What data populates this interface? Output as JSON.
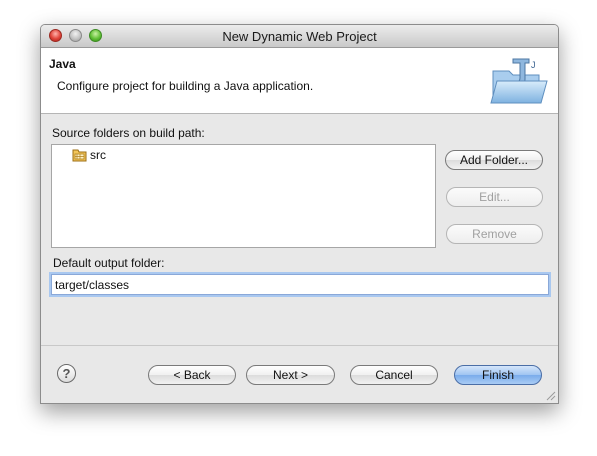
{
  "window": {
    "title": "New Dynamic Web Project"
  },
  "banner": {
    "title": "Java",
    "description": "Configure project for building a Java application.",
    "graphic_icon": "java-folder-icon"
  },
  "source": {
    "label": "Source folders on build path:",
    "items": [
      {
        "label": "src",
        "icon": "source-folder-icon"
      }
    ],
    "buttons": {
      "add": "Add Folder...",
      "edit": "Edit...",
      "remove": "Remove"
    }
  },
  "output": {
    "label": "Default output folder:",
    "value": "target/classes"
  },
  "footer": {
    "help_icon": "help-icon",
    "back": "< Back",
    "next": "Next >",
    "cancel": "Cancel",
    "finish": "Finish"
  },
  "colors": {
    "default_button": "#7aaceb",
    "focus_ring": "#a9c8f0"
  }
}
